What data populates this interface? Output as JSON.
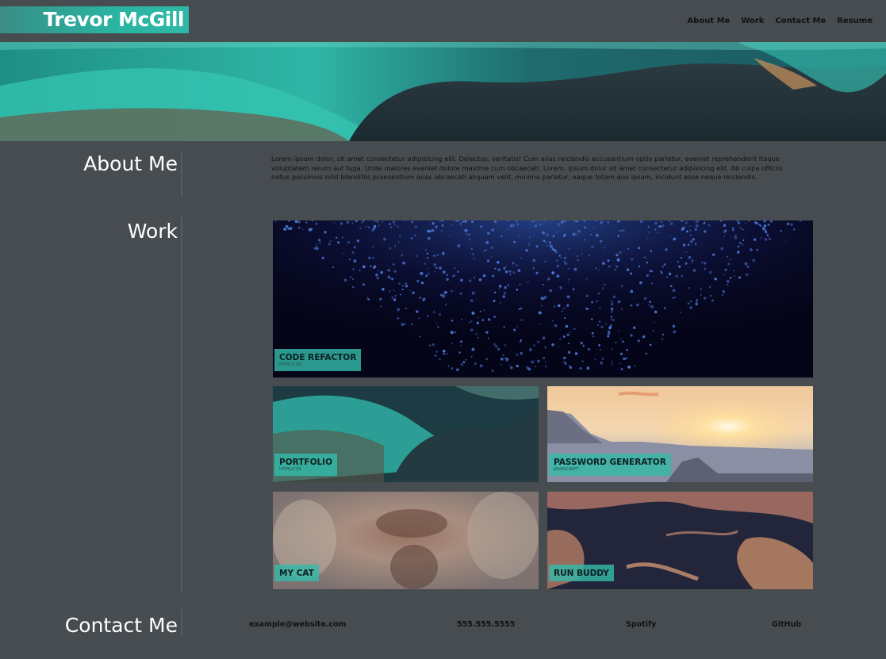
{
  "header": {
    "name": "Trevor McGill",
    "nav": [
      "About Me",
      "Work",
      "Contact Me",
      "Resume"
    ]
  },
  "sections": {
    "about_title": "About Me",
    "work_title": "Work",
    "contact_title": "Contact Me"
  },
  "about": {
    "text": "Lorem ipsum dolor, sit amet consectetur adipisicing elit. Delectus, veritatis! Cum alias reiciendis accusantium optio pariatur, eveniet reprehenderit itaque voluptatem rerum aut fuga. Unde maiores eveniet dolore maxime cum obcaecati. Lorem, ipsum dolor sit amet consectetur adipisicing elit. Ab culpa officiis natus possimus nihil blanditiis praesentium quas obcaecati aliquam velit, minima pariatur, eaque totam quo ipsam, incidunt esse neque reiciendis."
  },
  "work": [
    {
      "title": "CODE REFACTOR",
      "tech": "HTML/CSS"
    },
    {
      "title": "PORTFOLIO",
      "tech": "HTML/CSS"
    },
    {
      "title": "PASSWORD GENERATOR",
      "tech": "JAVASCRIPT"
    },
    {
      "title": "MY CAT",
      "tech": ""
    },
    {
      "title": "RUN BUDDY",
      "tech": ""
    }
  ],
  "contact": {
    "email": "example@website.com",
    "phone": "555.555.5555",
    "spotify": "Spotify",
    "github": "GitHub"
  },
  "colors": {
    "background": "#474c50",
    "accent": "#35baa8"
  }
}
